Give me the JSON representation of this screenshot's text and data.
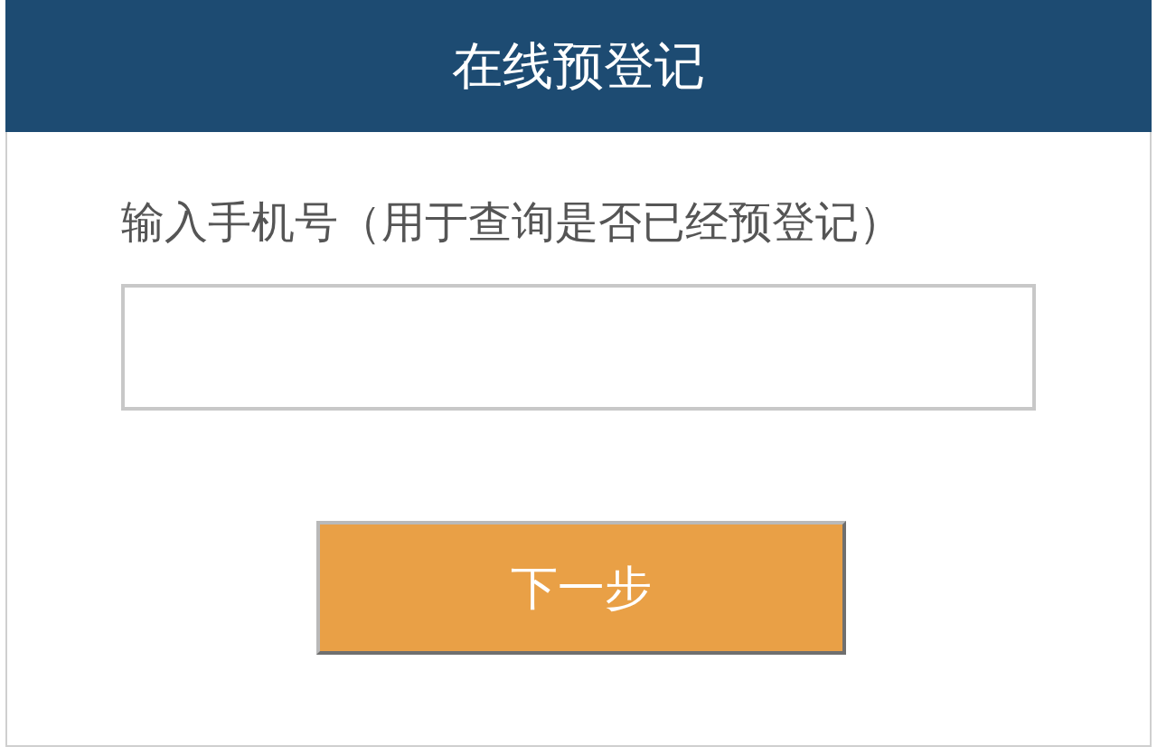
{
  "header": {
    "title": "在线预登记"
  },
  "form": {
    "label": "输入手机号（用于查询是否已经预登记）",
    "next_button": "下一步"
  }
}
